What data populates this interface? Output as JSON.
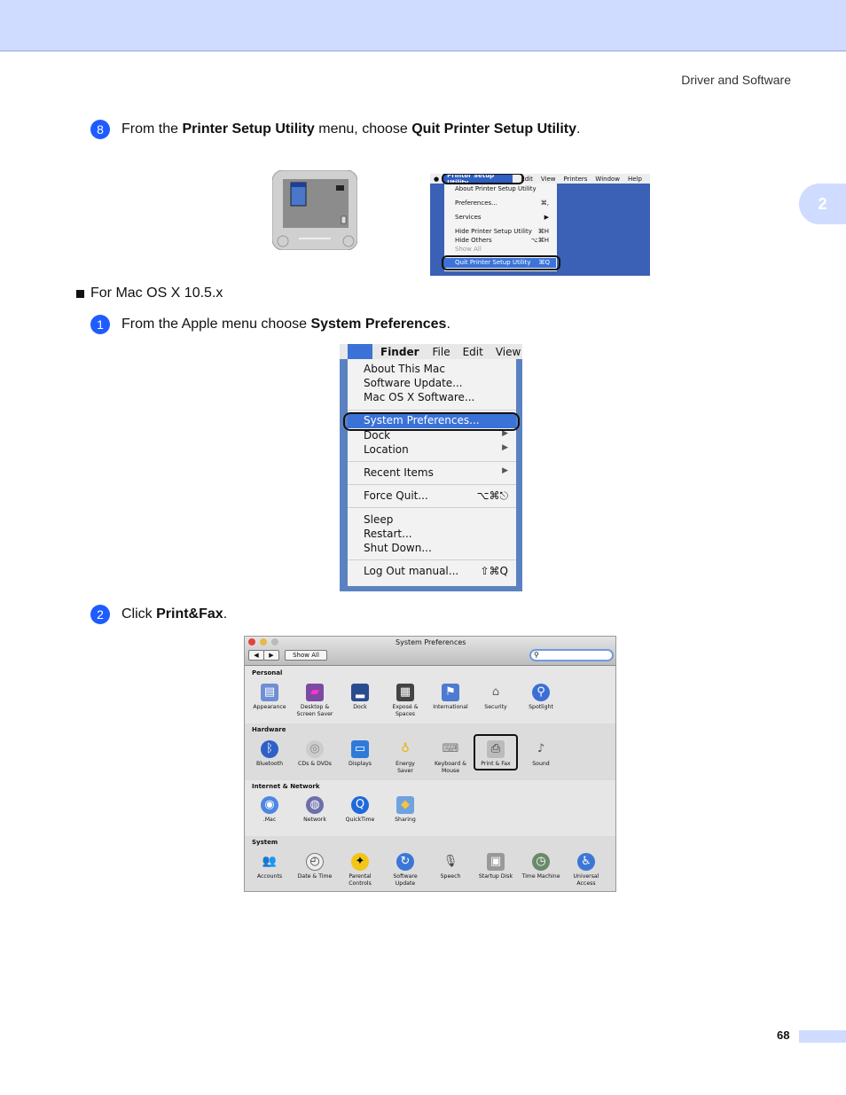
{
  "header": {
    "section": "Driver and Software",
    "chapter_tab": "2"
  },
  "step8": {
    "num": "8",
    "pre": "From the ",
    "b1": "Printer Setup Utility",
    "mid": " menu, choose ",
    "b2": "Quit Printer Setup Utility",
    "post": "."
  },
  "psu_menu": {
    "bar": [
      "Printer Setup Utility",
      "Edit",
      "View",
      "Printers",
      "Window",
      "Help"
    ],
    "items": {
      "about": "About Printer Setup Utility",
      "prefs": "Preferences...",
      "prefs_sc": "⌘,",
      "services": "Services",
      "services_sc": "▶",
      "hide": "Hide Printer Setup Utility",
      "hide_sc": "⌘H",
      "hide_others": "Hide Others",
      "hide_others_sc": "⌥⌘H",
      "show_all": "Show All",
      "quit": "Quit Printer Setup Utility",
      "quit_sc": "⌘Q"
    }
  },
  "bullet": "For Mac OS X 10.5.x",
  "step1": {
    "num": "1",
    "pre": "From the Apple menu choose ",
    "b1": "System Preferences",
    "post": "."
  },
  "apple_menu": {
    "bar": [
      "Finder",
      "File",
      "Edit",
      "View"
    ],
    "about": "About This Mac",
    "software_update": "Software Update...",
    "macosx_software": "Mac OS X Software...",
    "system_prefs": "System Preferences...",
    "dock": "Dock",
    "location": "Location",
    "recent": "Recent Items",
    "force_quit": "Force Quit...",
    "force_quit_sc": "⌥⌘⎋",
    "sleep": "Sleep",
    "restart": "Restart...",
    "shutdown": "Shut Down...",
    "logout": "Log Out manual...",
    "logout_sc": "⇧⌘Q",
    "arrow": "▶"
  },
  "step2": {
    "num": "2",
    "pre": "Click ",
    "b1": "Print&Fax",
    "post": "."
  },
  "sysprefs": {
    "title": "System Preferences",
    "show_all": "Show All",
    "search_value": "",
    "sections": {
      "personal": "Personal",
      "hardware": "Hardware",
      "internet": "Internet & Network",
      "system": "System"
    },
    "personal": [
      {
        "label1": "Appearance",
        "label2": ""
      },
      {
        "label1": "Desktop &",
        "label2": "Screen Saver"
      },
      {
        "label1": "Dock",
        "label2": ""
      },
      {
        "label1": "Exposé &",
        "label2": "Spaces"
      },
      {
        "label1": "International",
        "label2": ""
      },
      {
        "label1": "Security",
        "label2": ""
      },
      {
        "label1": "Spotlight",
        "label2": ""
      }
    ],
    "hardware": [
      {
        "label1": "Bluetooth",
        "label2": ""
      },
      {
        "label1": "CDs & DVDs",
        "label2": ""
      },
      {
        "label1": "Displays",
        "label2": ""
      },
      {
        "label1": "Energy",
        "label2": "Saver"
      },
      {
        "label1": "Keyboard &",
        "label2": "Mouse"
      },
      {
        "label1": "Print & Fax",
        "label2": ""
      },
      {
        "label1": "Sound",
        "label2": ""
      }
    ],
    "internet": [
      {
        "label1": ".Mac",
        "label2": ""
      },
      {
        "label1": "Network",
        "label2": ""
      },
      {
        "label1": "QuickTime",
        "label2": ""
      },
      {
        "label1": "Sharing",
        "label2": ""
      }
    ],
    "system": [
      {
        "label1": "Accounts",
        "label2": ""
      },
      {
        "label1": "Date & Time",
        "label2": ""
      },
      {
        "label1": "Parental",
        "label2": "Controls"
      },
      {
        "label1": "Software",
        "label2": "Update"
      },
      {
        "label1": "Speech",
        "label2": ""
      },
      {
        "label1": "Startup Disk",
        "label2": ""
      },
      {
        "label1": "Time Machine",
        "label2": ""
      },
      {
        "label1": "Universal",
        "label2": "Access"
      }
    ]
  },
  "footer": {
    "page": "68"
  }
}
